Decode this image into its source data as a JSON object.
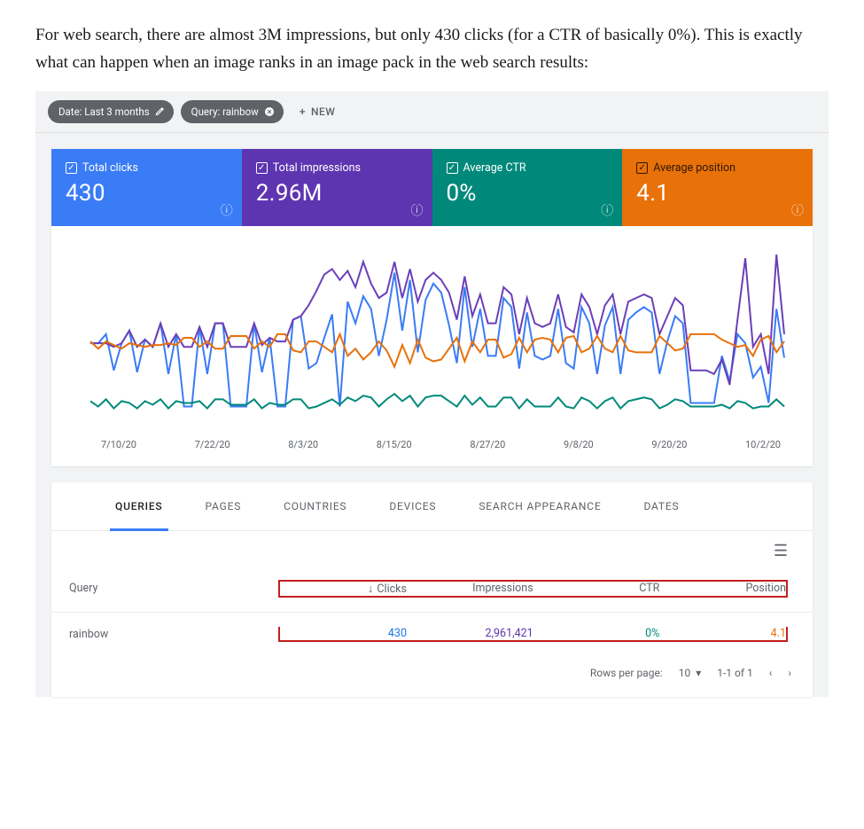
{
  "intro_text": "For web search, there are almost 3M impressions, but only 430 clicks (for a CTR of basically 0%). This is exactly what can happen when an image ranks in an image pack in the web search results:",
  "filters": {
    "date_label": "Date: Last 3 months",
    "query_label": "Query: rainbow",
    "new_label": "NEW"
  },
  "metrics": {
    "clicks": {
      "label": "Total clicks",
      "value": "430"
    },
    "impressions": {
      "label": "Total impressions",
      "value": "2.96M"
    },
    "ctr": {
      "label": "Average CTR",
      "value": "0%"
    },
    "position": {
      "label": "Average position",
      "value": "4.1"
    }
  },
  "chart_data": {
    "type": "line",
    "title": "",
    "x_ticks": [
      "7/10/20",
      "7/22/20",
      "8/3/20",
      "8/15/20",
      "8/27/20",
      "9/8/20",
      "9/20/20",
      "10/2/20"
    ],
    "ylim": [
      0,
      100
    ],
    "x_count": 90,
    "series": [
      {
        "name": "Total clicks",
        "color": "#3a7cf5",
        "values": [
          47,
          47,
          52,
          32,
          47,
          54,
          31,
          49,
          45,
          58,
          30,
          52,
          12,
          12,
          56,
          30,
          58,
          58,
          12,
          12,
          12,
          58,
          31,
          50,
          12,
          12,
          60,
          62,
          33,
          36,
          50,
          63,
          12,
          70,
          58,
          73,
          66,
          40,
          60,
          86,
          54,
          82,
          42,
          71,
          80,
          75,
          57,
          36,
          78,
          45,
          66,
          40,
          40,
          72,
          67,
          33,
          64,
          40,
          38,
          40,
          66,
          36,
          33,
          67,
          58,
          30,
          57,
          67,
          30,
          60,
          64,
          67,
          64,
          30,
          48,
          62,
          58,
          14,
          14,
          14,
          14,
          40,
          26,
          52,
          47,
          28,
          34,
          14,
          66,
          39
        ]
      },
      {
        "name": "Total impressions",
        "color": "#6b3fb8",
        "values": [
          47,
          47,
          47,
          45,
          47,
          54,
          45,
          49,
          45,
          58,
          45,
          52,
          45,
          45,
          56,
          45,
          58,
          58,
          45,
          45,
          45,
          58,
          46,
          50,
          48,
          48,
          60,
          62,
          68,
          76,
          85,
          88,
          82,
          87,
          78,
          92,
          80,
          72,
          75,
          92,
          72,
          88,
          70,
          82,
          86,
          82,
          75,
          60,
          84,
          62,
          74,
          58,
          58,
          78,
          74,
          52,
          72,
          58,
          56,
          58,
          74,
          56,
          53,
          74,
          67,
          52,
          68,
          74,
          52,
          70,
          72,
          74,
          72,
          52,
          62,
          72,
          68,
          32,
          32,
          32,
          30,
          38,
          24,
          60,
          94,
          45,
          52,
          30,
          96,
          52
        ]
      },
      {
        "name": "Average CTR",
        "color": "#00897b",
        "values": [
          15,
          12,
          16,
          11,
          15,
          14,
          11,
          15,
          13,
          16,
          11,
          15,
          14,
          14,
          15,
          11,
          16,
          16,
          13,
          13,
          13,
          16,
          11,
          14,
          13,
          13,
          16,
          16,
          11,
          12,
          14,
          16,
          13,
          17,
          15,
          18,
          17,
          12,
          16,
          19,
          15,
          18,
          12,
          17,
          18,
          18,
          15,
          12,
          18,
          13,
          17,
          12,
          12,
          17,
          17,
          11,
          16,
          12,
          12,
          12,
          17,
          12,
          11,
          17,
          15,
          11,
          15,
          17,
          11,
          15,
          16,
          17,
          16,
          11,
          13,
          16,
          15,
          12,
          12,
          12,
          12,
          13,
          11,
          15,
          14,
          11,
          12,
          12,
          16,
          12
        ]
      },
      {
        "name": "Average position",
        "color": "#e8710a",
        "values": [
          48,
          44,
          48,
          46,
          44,
          47,
          46,
          45,
          46,
          46,
          47,
          46,
          50,
          50,
          45,
          48,
          44,
          44,
          51,
          51,
          51,
          44,
          48,
          45,
          52,
          52,
          43,
          42,
          48,
          48,
          45,
          42,
          52,
          40,
          44,
          38,
          42,
          48,
          43,
          34,
          46,
          36,
          49,
          39,
          37,
          38,
          44,
          50,
          37,
          48,
          42,
          49,
          49,
          39,
          41,
          50,
          42,
          49,
          50,
          49,
          42,
          50,
          51,
          42,
          44,
          51,
          44,
          42,
          51,
          43,
          42,
          42,
          42,
          51,
          47,
          43,
          44,
          52,
          52,
          52,
          52,
          49,
          47,
          45,
          46,
          40,
          49,
          51,
          42,
          48
        ]
      }
    ]
  },
  "tabs": [
    "QUERIES",
    "PAGES",
    "COUNTRIES",
    "DEVICES",
    "SEARCH APPEARANCE",
    "DATES"
  ],
  "active_tab": 0,
  "table": {
    "headers": {
      "query": "Query",
      "clicks": "Clicks",
      "impressions": "Impressions",
      "ctr": "CTR",
      "position": "Position"
    },
    "rows": [
      {
        "query": "rainbow",
        "clicks": "430",
        "impressions": "2,961,421",
        "ctr": "0%",
        "position": "4.1"
      }
    ]
  },
  "pager": {
    "rows_label": "Rows per page:",
    "rows_value": "10",
    "range": "1-1 of 1"
  }
}
